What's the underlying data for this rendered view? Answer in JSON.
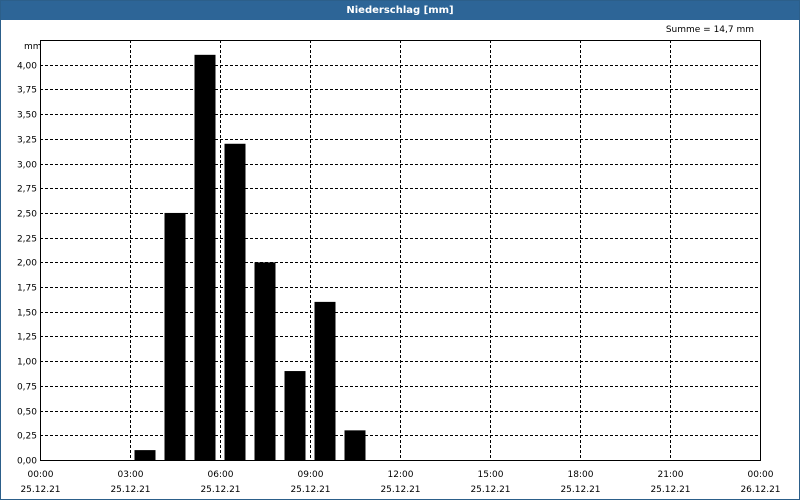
{
  "window": {
    "title": "Niederschlag [mm]"
  },
  "summary": "Summe = 14,7 mm",
  "colors": {
    "titlebar": "#2d6597",
    "bars": "#000000",
    "grid": "#000000"
  },
  "chart_data": {
    "type": "bar",
    "title": "Niederschlag [mm]",
    "ylabel": "mm",
    "ylim": [
      0,
      4.25
    ],
    "grid": true,
    "y_ticks": [
      "0,00",
      "0,25",
      "0,50",
      "0,75",
      "1,00",
      "1,25",
      "1,50",
      "1,75",
      "2,00",
      "2,25",
      "2,50",
      "2,75",
      "3,00",
      "3,25",
      "3,50",
      "3,75",
      "4,00"
    ],
    "x_ticks": [
      {
        "time": "00:00",
        "date": "25.12.21"
      },
      {
        "time": "03:00",
        "date": "25.12.21"
      },
      {
        "time": "06:00",
        "date": "25.12.21"
      },
      {
        "time": "09:00",
        "date": "25.12.21"
      },
      {
        "time": "12:00",
        "date": "25.12.21"
      },
      {
        "time": "15:00",
        "date": "25.12.21"
      },
      {
        "time": "18:00",
        "date": "25.12.21"
      },
      {
        "time": "21:00",
        "date": "25.12.21"
      },
      {
        "time": "00:00",
        "date": "26.12.21"
      }
    ],
    "x_range_hours": [
      0,
      24
    ],
    "bars": [
      {
        "hour": 3,
        "value": 0.1
      },
      {
        "hour": 4,
        "value": 2.5
      },
      {
        "hour": 5,
        "value": 4.1
      },
      {
        "hour": 6,
        "value": 3.2
      },
      {
        "hour": 7,
        "value": 2.0
      },
      {
        "hour": 8,
        "value": 0.9
      },
      {
        "hour": 9,
        "value": 1.6
      },
      {
        "hour": 10,
        "value": 0.3
      }
    ]
  }
}
